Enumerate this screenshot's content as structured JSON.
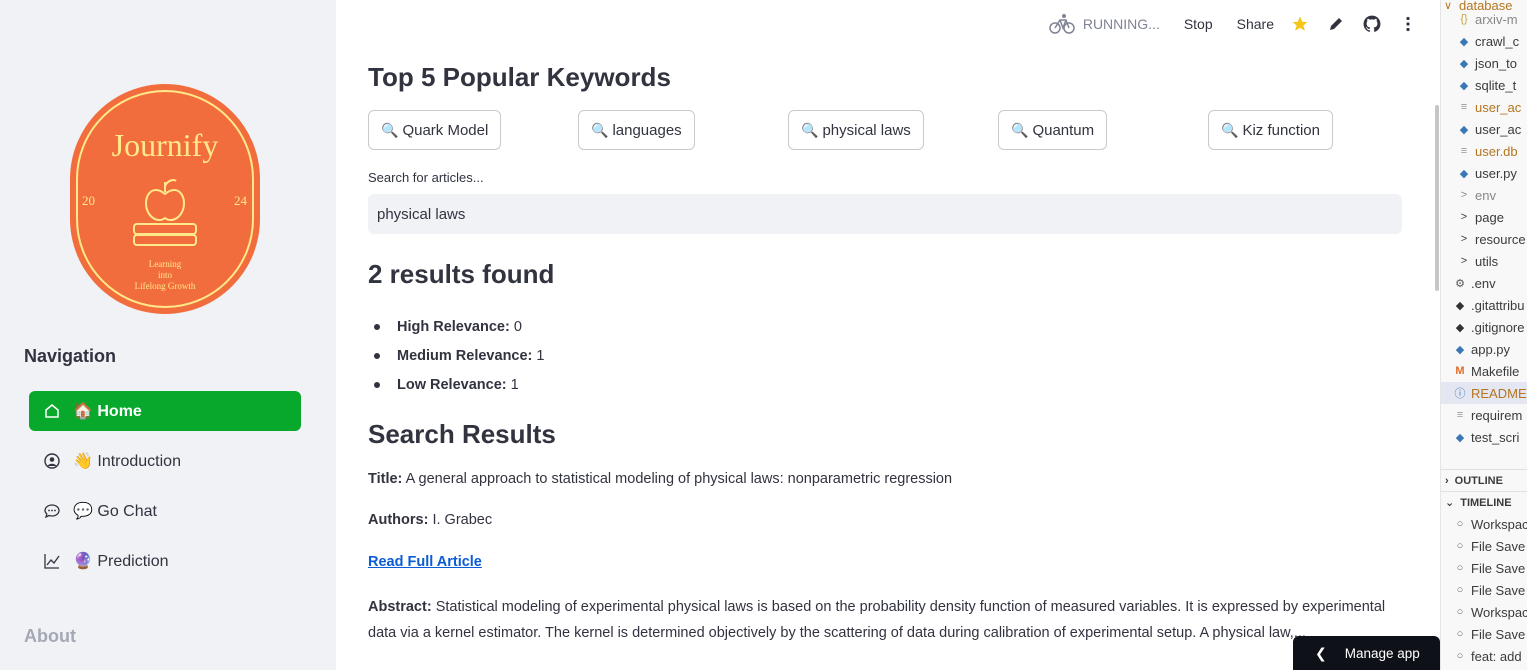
{
  "topbar": {
    "running_label": "RUNNING...",
    "stop_label": "Stop",
    "share_label": "Share"
  },
  "sidebar": {
    "logo": {
      "title": "Journify",
      "year_left": "20",
      "year_right": "24",
      "tagline_1": "Learning",
      "tagline_2": "into",
      "tagline_3": "Lifelong Growth"
    },
    "nav_title": "Navigation",
    "items": [
      {
        "label": "🏠 Home",
        "icon": "home-icon"
      },
      {
        "label": "👋 Introduction",
        "icon": "user-circle-icon"
      },
      {
        "label": "💬 Go Chat",
        "icon": "chat-icon"
      },
      {
        "label": "🔮 Prediction",
        "icon": "chart-line-icon"
      }
    ],
    "about": "About"
  },
  "main": {
    "keywords_heading": "Top 5 Popular Keywords",
    "keywords": [
      "Quark Model",
      "languages",
      "physical laws",
      "Quantum",
      "Kiz function"
    ],
    "search_label": "Search for articles...",
    "search_value": "physical laws",
    "results_heading": "2 results found",
    "relevance": [
      {
        "label": "High Relevance:",
        "value": "0"
      },
      {
        "label": "Medium Relevance:",
        "value": "1"
      },
      {
        "label": "Low Relevance:",
        "value": "1"
      }
    ],
    "search_results_heading": "Search Results",
    "result": {
      "title_label": "Title:",
      "title": "A general approach to statistical modeling of physical laws: nonparametric regression",
      "authors_label": "Authors:",
      "authors": "I. Grabec",
      "read_link": "Read Full Article",
      "abstract_label": "Abstract:",
      "abstract": "Statistical modeling of experimental physical laws is based on the probability density function of measured variables. It is expressed by experimental data via a kernel estimator. The kernel is determined objectively by the scattering of data during calibration of experimental setup. A physical law,..."
    }
  },
  "editor": {
    "rows": [
      {
        "label": "database",
        "glyph": "∨"
      },
      {
        "label": "arxiv-m",
        "glyph": "{}"
      },
      {
        "label": "crawl_c",
        "glyph": "◆"
      },
      {
        "label": "json_to",
        "glyph": "◆"
      },
      {
        "label": "sqlite_t",
        "glyph": "◆"
      },
      {
        "label": "user_ac",
        "glyph": "≡"
      },
      {
        "label": "user_ac",
        "glyph": "◆"
      },
      {
        "label": "user.db",
        "glyph": "≡"
      },
      {
        "label": "user.py",
        "glyph": "◆"
      },
      {
        "label": "env",
        "glyph": ">"
      },
      {
        "label": "page",
        "glyph": ">"
      },
      {
        "label": "resource",
        "glyph": ">"
      },
      {
        "label": "utils",
        "glyph": ">"
      },
      {
        "label": ".env",
        "glyph": "⚙"
      },
      {
        "label": ".gitattribu",
        "glyph": "◆"
      },
      {
        "label": ".gitignore",
        "glyph": "◆"
      },
      {
        "label": "app.py",
        "glyph": "◆"
      },
      {
        "label": "Makefile",
        "glyph": "M"
      },
      {
        "label": "READMEm",
        "glyph": "ⓘ"
      },
      {
        "label": "requirem",
        "glyph": "≡"
      },
      {
        "label": "test_scri",
        "glyph": "◆"
      }
    ],
    "outline": "OUTLINE",
    "timeline": "TIMELINE",
    "timeline_rows": [
      "Workspac",
      "File Save",
      "File Save",
      "File Save",
      "Workspac",
      "File Save",
      "feat: add"
    ]
  },
  "manage_app": "Manage app",
  "colors": {
    "primary": "#07a82b",
    "logo_orange": "#f26d3d",
    "logo_yellow": "#ffe98a",
    "link": "#0b5cd5",
    "star": "#f5c518"
  }
}
